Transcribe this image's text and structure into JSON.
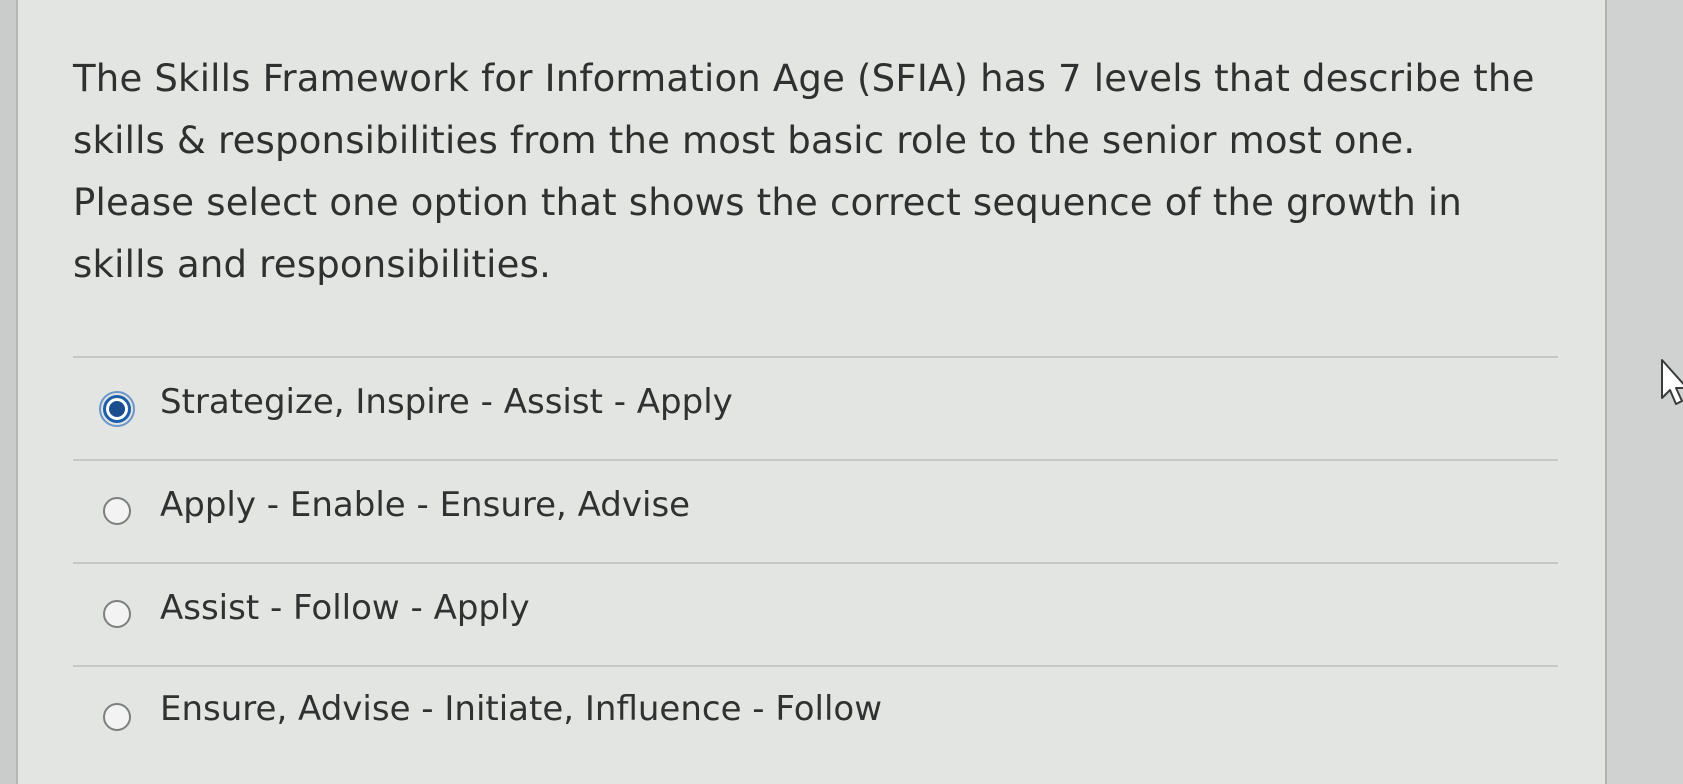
{
  "question": {
    "text": "The Skills Framework for Information Age (SFIA) has 7 levels that describe the skills & responsibilities from the most basic role to the senior most one. Please select one option that shows the correct sequence of the growth in skills and responsibilities."
  },
  "options": [
    {
      "label": "Strategize, Inspire - Assist - Apply",
      "selected": true
    },
    {
      "label": "Apply - Enable - Ensure, Advise",
      "selected": false
    },
    {
      "label": "Assist - Follow - Apply",
      "selected": false
    },
    {
      "label": "Ensure, Advise - Initiate, Influence - Follow",
      "selected": false
    }
  ],
  "colors": {
    "selected_radio": "#1c5fa8",
    "text": "#303131",
    "background": "#e3e5e3"
  },
  "icons": {
    "cursor": "mouse-pointer-icon"
  }
}
